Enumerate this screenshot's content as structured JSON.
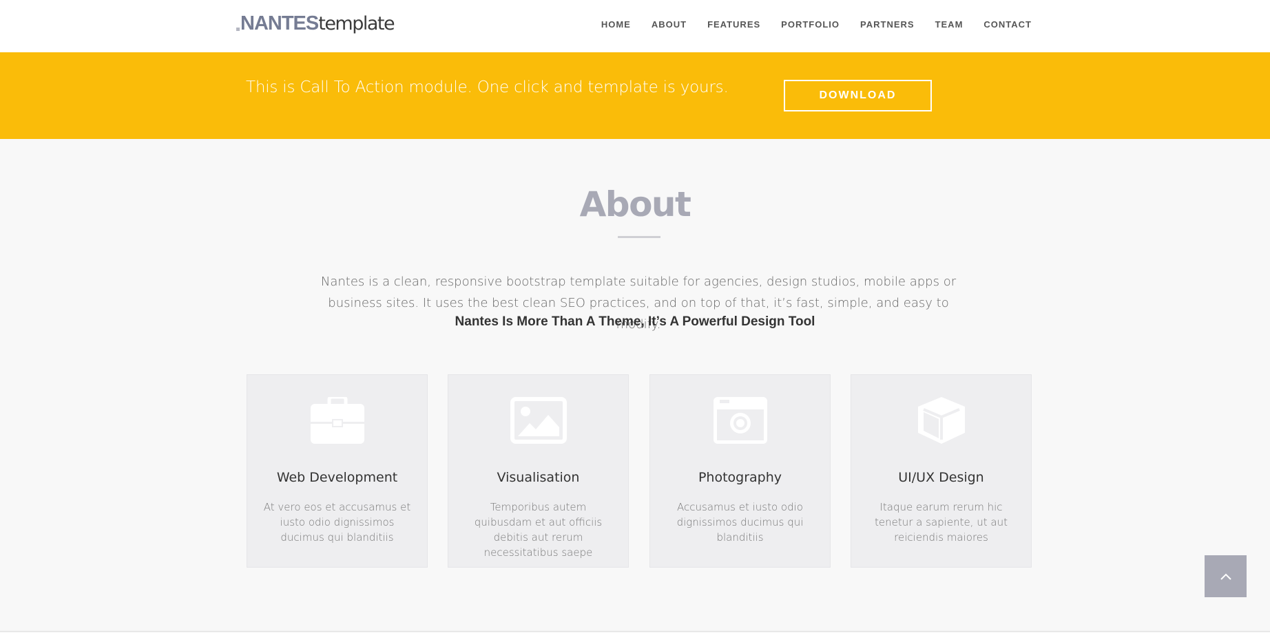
{
  "header": {
    "logo_bold": "NANTES",
    "logo_light": "template",
    "nav": [
      "HOME",
      "ABOUT",
      "FEATURES",
      "PORTFOLIO",
      "PARTNERS",
      "TEAM",
      "CONTACT"
    ]
  },
  "cta": {
    "text": "This is Call To Action module. One click and template is yours.",
    "button_label": "DOWNLOAD"
  },
  "about": {
    "title": "About",
    "description": "Nantes is a clean, responsive bootstrap template suitable for agencies, design studios, mobile apps or business sites. It uses the best clean SEO practices, and on top of that, it’s fast, simple, and easy to modify.",
    "tagline": "Nantes Is More Than A Theme, It’s A Powerful Design Tool"
  },
  "features": [
    {
      "icon": "briefcase-icon",
      "title": "Web Development",
      "text": "At vero eos et accusamus et iusto odio dignissimos ducimus qui blanditiis"
    },
    {
      "icon": "image-icon",
      "title": "Visualisation",
      "text": "Temporibus autem quibusdam et aut officiis debitis aut rerum necessitatibus saepe"
    },
    {
      "icon": "camera-icon",
      "title": "Photography",
      "text": "Accusamus et iusto odio dignissimos ducimus qui blanditiis"
    },
    {
      "icon": "cube-icon",
      "title": "UI/UX Design",
      "text": "Itaque earum rerum hic tenetur a sapiente, ut aut reiciendis maiores"
    }
  ],
  "colors": {
    "accent": "#fabc09",
    "title_gray": "#a8a9b5",
    "logo_blue": "#757c93"
  },
  "back_to_top_icon": "chevron-up-icon"
}
